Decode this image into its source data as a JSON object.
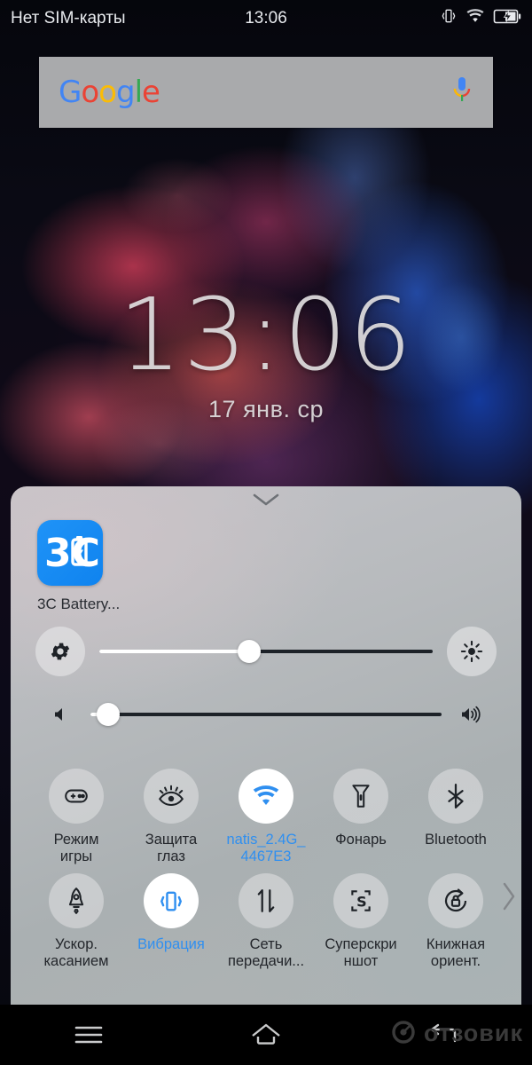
{
  "status_bar": {
    "carrier": "Нет SIM-карты",
    "time": "13:06",
    "icons": [
      "vibrate-icon",
      "wifi-icon",
      "battery-charging-icon"
    ]
  },
  "google_widget": {
    "logo_letters": [
      "G",
      "o",
      "o",
      "g",
      "l",
      "e"
    ],
    "mic_icon": "microphone-icon"
  },
  "clock_widget": {
    "time": "13:06",
    "date": "17 янв.  ср"
  },
  "quick_panel": {
    "handle_icon": "chevron-down-icon",
    "notification": {
      "app_icon_text": "3C",
      "app_label": "3C Battery..."
    },
    "brightness_slider": {
      "left_icon": "gear-icon",
      "right_icon": "brightness-sun-icon",
      "value_percent": 45
    },
    "volume_slider": {
      "left_icon": "volume-mute-icon",
      "right_icon": "volume-high-icon",
      "value_percent": 5
    },
    "toggles_row1": [
      {
        "label": "Режим\nигры",
        "icon": "game-mode-icon",
        "active": false
      },
      {
        "label": "Защита\nглаз",
        "icon": "eye-protect-icon",
        "active": false
      },
      {
        "label": "natis_2.4G_\n4467E3",
        "icon": "wifi-icon",
        "active": true
      },
      {
        "label": "Фонарь",
        "icon": "flashlight-icon",
        "active": false
      },
      {
        "label": "Bluetooth",
        "icon": "bluetooth-icon",
        "active": false
      }
    ],
    "toggles_row2": [
      {
        "label": "Ускор.\nкасанием",
        "icon": "rocket-icon",
        "active": false
      },
      {
        "label": "Вибрация",
        "icon": "vibrate-icon",
        "active": true
      },
      {
        "label": "Сеть\nпередачи...",
        "icon": "data-transfer-icon",
        "active": false
      },
      {
        "label": "Суперскри\nншот",
        "icon": "superscreenshot-icon",
        "active": false
      },
      {
        "label": "Книжная\nориент.",
        "icon": "rotation-lock-icon",
        "active": false
      }
    ],
    "next_page_icon": "chevron-right-icon"
  },
  "nav_bar": {
    "menu_icon": "menu-icon",
    "home_icon": "home-icon",
    "back_icon": "back-icon"
  },
  "watermark": {
    "text": "отзовик",
    "icon": "otzovik-logo-icon"
  },
  "colors": {
    "accent_blue": "#2f8ff0",
    "panel_gray": "#b4b8bb",
    "status_text": "#e8eaee"
  }
}
